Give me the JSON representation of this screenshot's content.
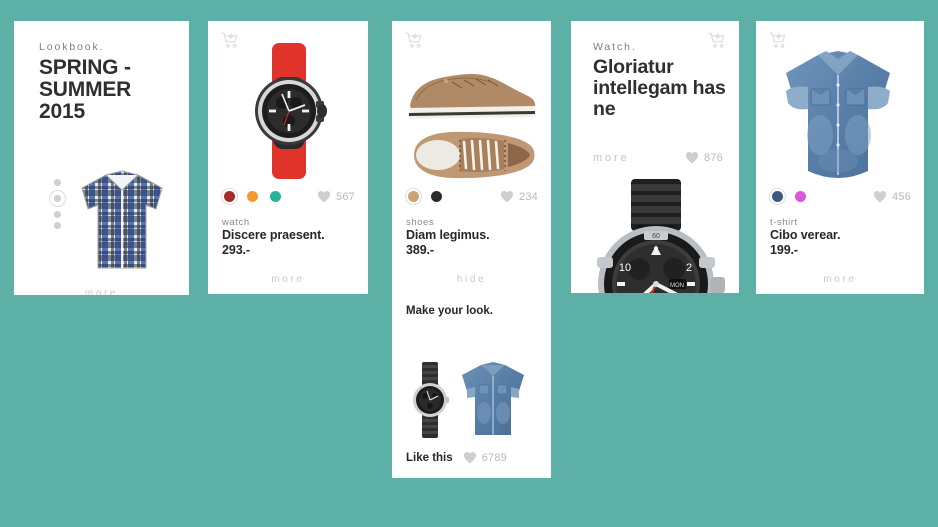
{
  "theme": {
    "background_color": "#5cb0a5",
    "card_background": "#ffffff",
    "text_primary": "#272727",
    "text_muted": "#8a8a8a",
    "link_muted": "#c4c4c4"
  },
  "cards": [
    {
      "id": "lookbook",
      "eyebrow": "Lookbook.",
      "headline": "SPRING - SUMMER 2015",
      "more_label": "more",
      "carousel_dots": 4,
      "carousel_active_index": 1,
      "image_name": "plaid-shirt-photo"
    },
    {
      "id": "watch-product",
      "cart_icon": "cart-add-icon",
      "image_name": "red-strap-chronograph-watch-photo",
      "swatches": [
        {
          "name": "dark-red",
          "color": "#a62b2b",
          "selected": true
        },
        {
          "name": "orange",
          "color": "#f29a2e",
          "selected": false
        },
        {
          "name": "teal",
          "color": "#25b49a",
          "selected": false
        }
      ],
      "likes": 567,
      "kicker": "watch",
      "title": "Discere praesent.",
      "price": "293.-",
      "more_label": "more"
    },
    {
      "id": "shoes",
      "cart_icon": "cart-add-icon",
      "image_name": "tan-sneakers-photo",
      "swatches": [
        {
          "name": "tan",
          "color": "#c9a477",
          "selected": true
        },
        {
          "name": "black",
          "color": "#2b2b2b",
          "selected": false
        }
      ],
      "likes": 234,
      "kicker": "shoes",
      "title": "Diam legimus.",
      "price": "389.-",
      "hide_label": "hide",
      "look_heading": "Make your look.",
      "look_items": [
        "black-steel-watch-photo",
        "denim-shirt-photo"
      ],
      "like_this_label": "Like this",
      "like_this_count": 6789
    },
    {
      "id": "watch-editorial",
      "cart_icon": "cart-add-icon",
      "eyebrow": "Watch.",
      "headline": "Gloriatur intellegam has ne",
      "more_label": "more",
      "likes": 876,
      "image_name": "black-chronograph-watch-photo"
    },
    {
      "id": "tshirt",
      "cart_icon": "cart-add-icon",
      "image_name": "denim-shirt-photo",
      "swatches": [
        {
          "name": "navy",
          "color": "#3d5a7d",
          "selected": true
        },
        {
          "name": "orchid",
          "color": "#d858d8",
          "selected": false
        }
      ],
      "likes": 456,
      "kicker": "t-shirt",
      "title": "Cibo verear.",
      "price": "199.-",
      "more_label": "more"
    }
  ]
}
